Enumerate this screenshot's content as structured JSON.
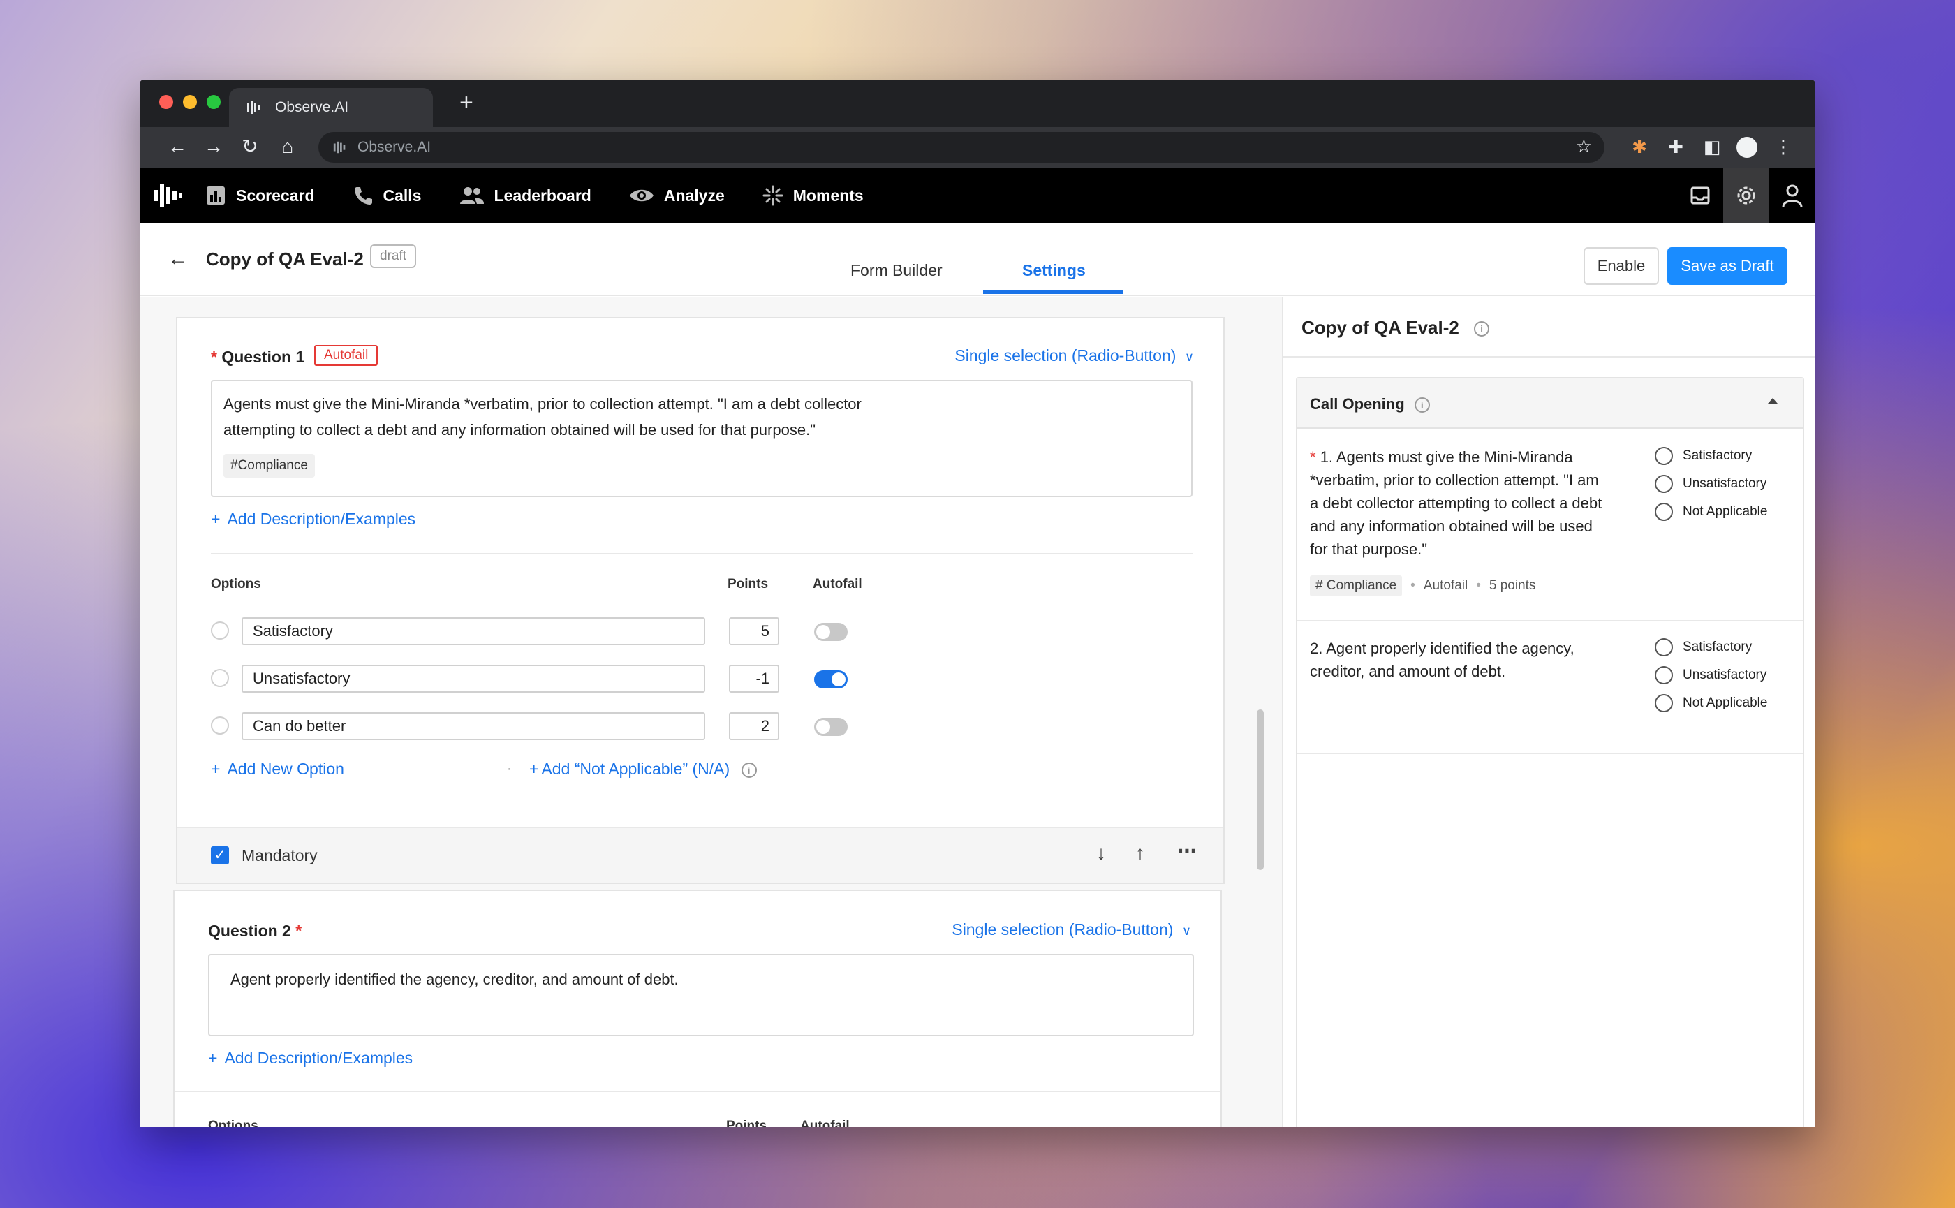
{
  "browser": {
    "tab_title": "Observe.AI",
    "url": "Observe.AI"
  },
  "nav": {
    "items": [
      {
        "label": "Scorecard",
        "icon": "bar-chart-icon"
      },
      {
        "label": "Calls",
        "icon": "phone-icon"
      },
      {
        "label": "Leaderboard",
        "icon": "people-icon"
      },
      {
        "label": "Analyze",
        "icon": "eye-icon"
      },
      {
        "label": "Moments",
        "icon": "sparkle-icon"
      }
    ]
  },
  "header": {
    "title": "Copy of QA Eval-2",
    "status": "draft",
    "tabs": [
      "Form Builder",
      "Settings"
    ],
    "active_tab": "Settings",
    "enable_label": "Enable",
    "save_label": "Save as Draft"
  },
  "colors": {
    "accent": "#1a73e8",
    "danger": "#e53935",
    "nav_bg": "#000000"
  },
  "questions": [
    {
      "label": "Question 1",
      "required": "*",
      "autofail_tag": "Autofail",
      "type": "Single selection (Radio-Button)",
      "text_line1": "Agents must give the Mini-Miranda *verbatim, prior to collection attempt. \"I am a debt collector",
      "text_line2": "attempting to collect a debt and any information obtained will be used for that purpose.\"",
      "tag": "#Compliance",
      "add_desc": "Add Description/Examples",
      "col_options": "Options",
      "col_points": "Points",
      "col_autofail": "Autofail",
      "options": [
        {
          "label": "Satisfactory",
          "points": "5",
          "autofail": false
        },
        {
          "label": "Unsatisfactory",
          "points": "-1",
          "autofail": true
        },
        {
          "label": "Can do better",
          "points": "2",
          "autofail": false
        }
      ],
      "add_option": "Add New Option",
      "add_na": "Add “Not Applicable” (N/A)",
      "mandatory": "Mandatory"
    },
    {
      "label": "Question 2",
      "required": "*",
      "type": "Single selection (Radio-Button)",
      "text": "Agent properly identified the agency, creditor, and amount of debt.",
      "add_desc": "Add Description/Examples",
      "col_options": "Options",
      "col_points": "Points",
      "col_autofail": "Autofail"
    }
  ],
  "preview": {
    "title": "Copy of QA Eval-2",
    "section": "Call Opening",
    "questions": [
      {
        "required": "*",
        "lines": [
          "1. Agents must give the Mini-Miranda",
          "*verbatim, prior to collection attempt. \"I am",
          "a debt collector attempting to collect a debt",
          "and any information obtained will be used",
          "for that purpose.\""
        ],
        "tag": "# Compliance",
        "autofail": "Autofail",
        "points": "5 points",
        "options": [
          "Satisfactory",
          "Unsatisfactory",
          "Not Applicable"
        ]
      },
      {
        "lines": [
          "2. Agent properly identified the agency,",
          "creditor, and amount of debt."
        ],
        "options": [
          "Satisfactory",
          "Unsatisfactory",
          "Not Applicable"
        ]
      }
    ]
  }
}
